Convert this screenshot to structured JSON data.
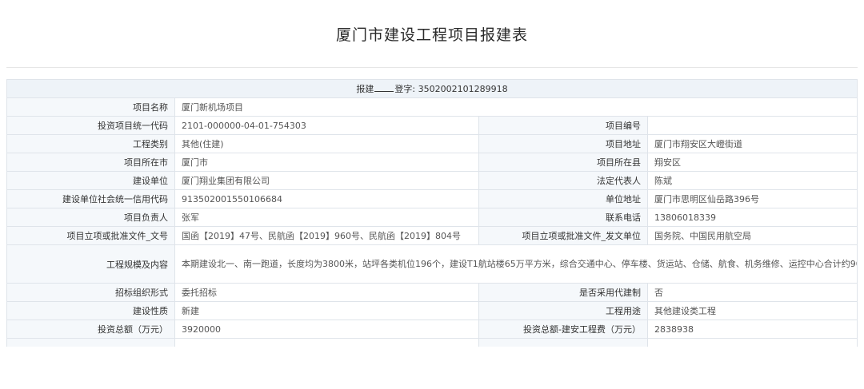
{
  "page": {
    "title": "厦门市建设工程项目报建表"
  },
  "form": {
    "header": {
      "prefix": "报建",
      "suffix": "登字: 3502002101289918"
    },
    "rows": {
      "project_name": {
        "label": "项目名称",
        "value": "厦门新机场项目"
      },
      "invest_code": {
        "label": "投资项目统一代码",
        "value": "2101-000000-04-01-754303"
      },
      "project_no": {
        "label": "项目编号",
        "value": ""
      },
      "category": {
        "label": "工程类别",
        "value": "其他(住建)"
      },
      "address": {
        "label": "项目地址",
        "value": "厦门市翔安区大嶝街道"
      },
      "city": {
        "label": "项目所在市",
        "value": "厦门市"
      },
      "county": {
        "label": "项目所在县",
        "value": "翔安区"
      },
      "builder": {
        "label": "建设单位",
        "value": "厦门翔业集团有限公司"
      },
      "legal_rep": {
        "label": "法定代表人",
        "value": "陈斌"
      },
      "credit_code": {
        "label": "建设单位社会统一信用代码",
        "value": "913502001550106684"
      },
      "unit_address": {
        "label": "单位地址",
        "value": "厦门市思明区仙岳路396号"
      },
      "manager": {
        "label": "项目负责人",
        "value": "张军"
      },
      "phone": {
        "label": "联系电话",
        "value": "13806018339"
      },
      "approval_doc_no": {
        "label": "项目立项或批准文件_文号",
        "value": "国函【2019】47号、民航函【2019】960号、民航函【2019】804号"
      },
      "approval_issuer": {
        "label": "项目立项或批准文件_发文单位",
        "value": "国务院、中国民用航空局"
      },
      "scale": {
        "label": "工程规模及内容",
        "value": "本期建设北一、南一跑道，长度均为3800米，站坪各类机位196个，建设T1航站楼65万平方米，综合交通中心、停车楼、货运站、仓储、航食、机务维修、运控中心合计约90万平方米。配套建设供电、雨污水、污物、供冷、燃气、通信、综合交通等设施。附：工程项目详表，"
      },
      "bidding": {
        "label": "招标组织形式",
        "value": "委托招标"
      },
      "agent_build": {
        "label": "是否采用代建制",
        "value": "否"
      },
      "nature": {
        "label": "建设性质",
        "value": "新建"
      },
      "usage": {
        "label": "工程用途",
        "value": "其他建设类工程"
      },
      "total_invest": {
        "label": "投资总额（万元）",
        "value": "3920000"
      },
      "install_cost": {
        "label": "投资总额-建安工程费（万元）",
        "value": "2838938"
      }
    }
  }
}
